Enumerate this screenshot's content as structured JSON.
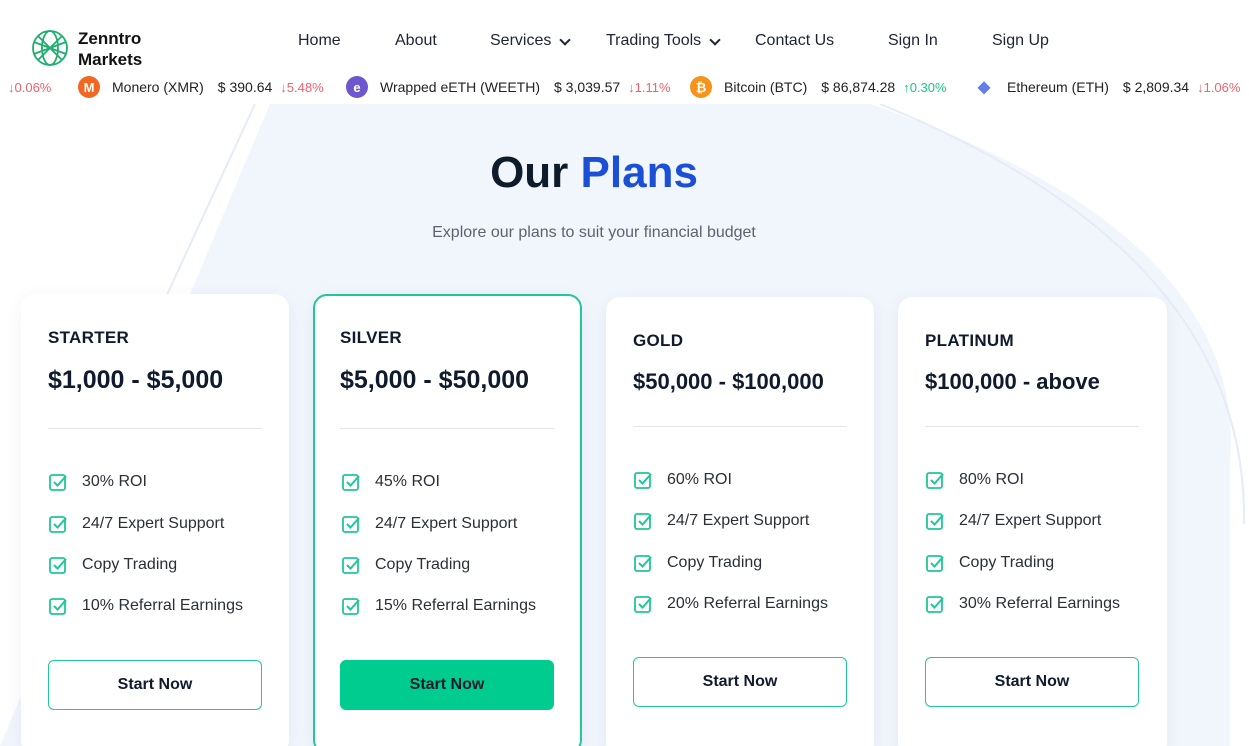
{
  "brand": {
    "name_line1": "Zenntro",
    "name_line2": "Markets"
  },
  "nav": {
    "home": "Home",
    "about": "About",
    "services": "Services",
    "trading_tools": "Trading Tools",
    "contact": "Contact Us",
    "sign_in": "Sign In",
    "sign_up": "Sign Up"
  },
  "ticker": {
    "lead_change": "0.06%",
    "items": [
      {
        "name": "Monero (XMR)",
        "price": "$ 390.64",
        "change": "5.48%",
        "direction": "down",
        "icon": "monero-icon",
        "color": "#f26822"
      },
      {
        "name": "Wrapped eETH (WEETH)",
        "price": "$ 3,039.57",
        "change": "1.11%",
        "direction": "down",
        "icon": "weeth-icon",
        "color": "#6e56cf"
      },
      {
        "name": "Bitcoin (BTC)",
        "price": "$ 86,874.28",
        "change": "0.30%",
        "direction": "up",
        "icon": "bitcoin-icon",
        "color": "#f7931a"
      },
      {
        "name": "Ethereum (ETH)",
        "price": "$ 2,809.34",
        "change": "1.06%",
        "direction": "down",
        "icon": "ethereum-icon",
        "color": "#627eea"
      }
    ]
  },
  "section": {
    "title_part1": "Our",
    "title_part2": "Plans",
    "subtitle": "Explore our plans to suit your financial budget"
  },
  "plans": [
    {
      "name": "STARTER",
      "price": "$1,000 - $5,000",
      "features": [
        "30% ROI",
        "24/7 Expert Support",
        "Copy Trading",
        "10% Referral Earnings"
      ],
      "cta": "Start Now"
    },
    {
      "name": "SILVER",
      "price": "$5,000 - $50,000",
      "features": [
        "45% ROI",
        "24/7 Expert Support",
        "Copy Trading",
        "15% Referral Earnings"
      ],
      "cta": "Start Now"
    },
    {
      "name": "GOLD",
      "price": "$50,000 - $100,000",
      "features": [
        "60% ROI",
        "24/7 Expert Support",
        "Copy Trading",
        "20% Referral Earnings"
      ],
      "cta": "Start Now"
    },
    {
      "name": "PLATINUM",
      "price": "$100,000 - above",
      "features": [
        "80% ROI",
        "24/7 Expert Support",
        "Copy Trading",
        "30% Referral Earnings"
      ],
      "cta": "Start Now"
    }
  ],
  "colors": {
    "accent_green": "#00cc8f",
    "accent_blue": "#1a4fd6",
    "down_red": "#f0616d",
    "up_green": "#16c784"
  }
}
